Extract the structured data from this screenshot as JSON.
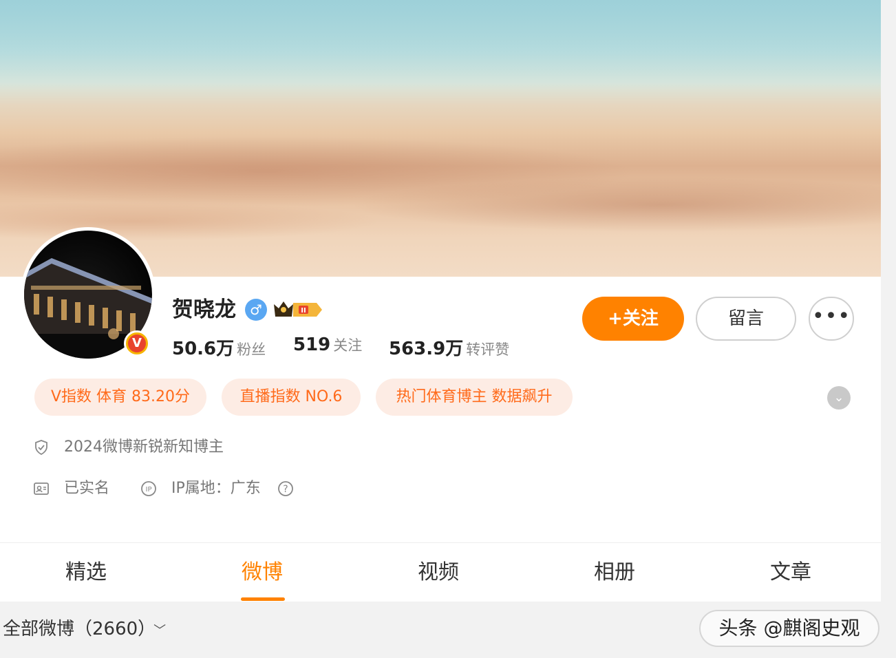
{
  "profile": {
    "name": "贺晓龙",
    "verified_badge": "V",
    "gender_icon": "male-icon",
    "level_badge": "crown-icon",
    "stats": [
      {
        "num": "50.6万",
        "label": "粉丝"
      },
      {
        "num": "519",
        "label": "关注"
      },
      {
        "num": "563.9万",
        "label": "转评赞"
      }
    ]
  },
  "actions": {
    "follow_label": "+关注",
    "message_label": "留言",
    "more_label": "•••"
  },
  "tags": [
    "V指数 体育 83.20分",
    "直播指数 NO.6",
    "热门体育博主 数据飙升"
  ],
  "info": {
    "honor": "2024微博新锐新知博主",
    "realname": "已实名",
    "ip_location": "IP属地：广东"
  },
  "tabs": [
    "精选",
    "微博",
    "视频",
    "相册",
    "文章"
  ],
  "active_tab": "微博",
  "feed": {
    "filter_label": "全部微博（2660）"
  },
  "watermark": "头条 @麒阁史观",
  "colors": {
    "accent": "#ff8200",
    "tag_bg": "#fdece4",
    "tag_text": "#ff6a1a"
  }
}
